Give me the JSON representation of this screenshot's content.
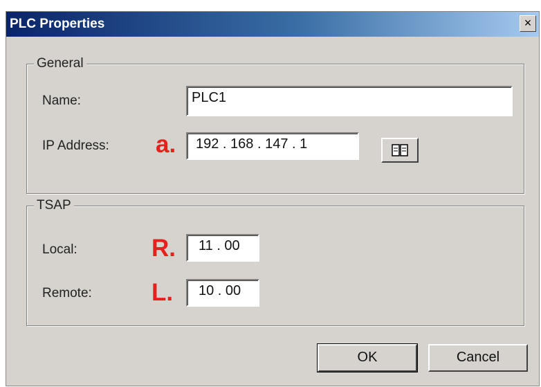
{
  "window": {
    "title": "PLC Properties",
    "close_label": "×"
  },
  "general": {
    "label": "General",
    "name_label": "Name:",
    "name_value": "PLC1",
    "ip_label": "IP Address:",
    "ip_marker": "a.",
    "ip_value": "192 . 168 . 147 .  1",
    "browse_icon": "address-book-icon"
  },
  "tsap": {
    "label": "TSAP",
    "local_label": "Local:",
    "local_marker": "R.",
    "local_value": "11 . 00",
    "remote_label": "Remote:",
    "remote_marker": "L.",
    "remote_value": "10 . 00"
  },
  "buttons": {
    "ok": "OK",
    "cancel": "Cancel"
  }
}
